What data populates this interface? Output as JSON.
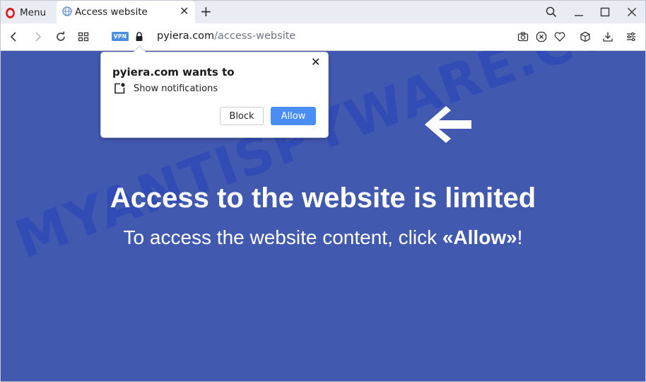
{
  "browser": {
    "menu_label": "Menu",
    "tab": {
      "title": "Access website"
    },
    "vpn_badge": "VPN",
    "url": {
      "domain": "pyiera.com",
      "path": "/access-website"
    }
  },
  "popup": {
    "title": "pyiera.com wants to",
    "permission": "Show notifications",
    "block_label": "Block",
    "allow_label": "Allow"
  },
  "page": {
    "headline": "Access to the website is limited",
    "subline_prefix": "To access the website content, click ",
    "subline_bold": "«Allow»",
    "subline_suffix": "!",
    "watermark": "MYANTISPYWARE.COM"
  },
  "colors": {
    "page_background": "#4259b0",
    "allow_button": "#4a8ef5",
    "vpn_badge": "#4a8fe0",
    "opera_red": "#e0171f"
  }
}
